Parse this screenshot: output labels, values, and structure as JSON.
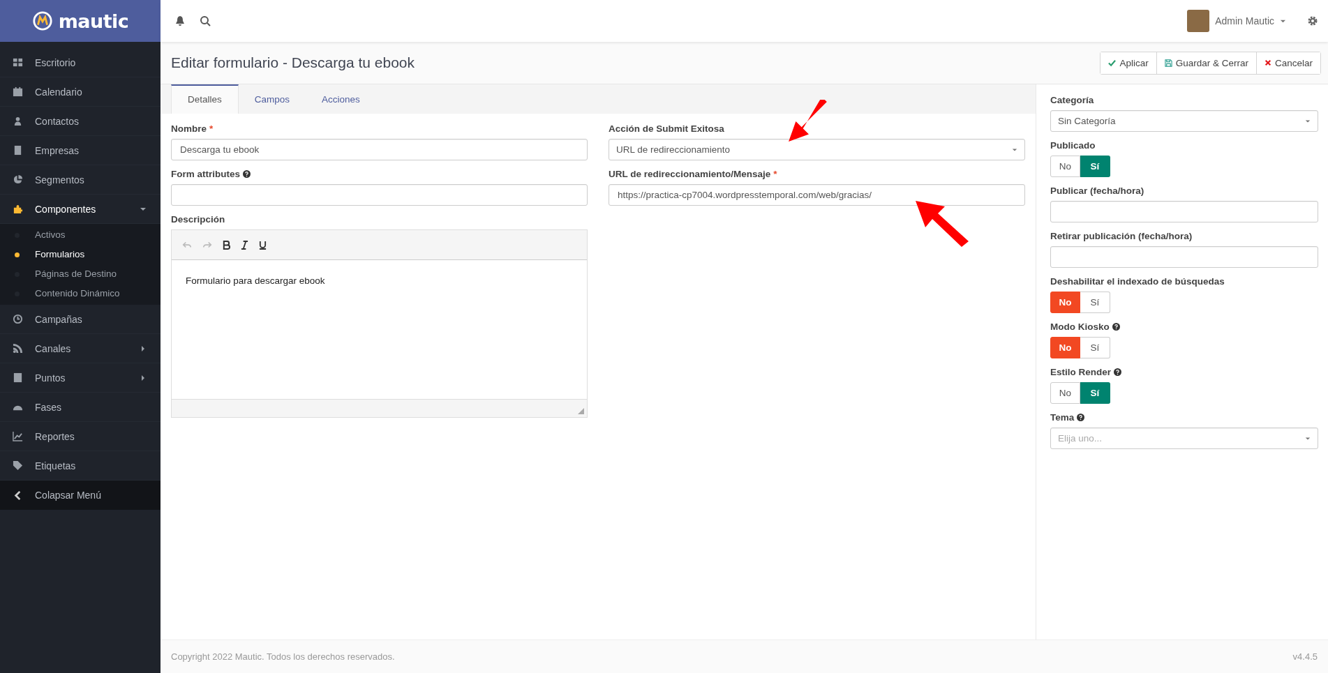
{
  "brand": {
    "name": "mautic"
  },
  "sidebar": {
    "items": [
      {
        "label": "Escritorio",
        "expanded": false,
        "has_submenu": false
      },
      {
        "label": "Calendario",
        "expanded": false,
        "has_submenu": false
      },
      {
        "label": "Contactos",
        "expanded": false,
        "has_submenu": false
      },
      {
        "label": "Empresas",
        "expanded": false,
        "has_submenu": false
      },
      {
        "label": "Segmentos",
        "expanded": false,
        "has_submenu": false
      },
      {
        "label": "Componentes",
        "expanded": true,
        "has_submenu": true,
        "children": [
          {
            "label": "Activos",
            "selected": false
          },
          {
            "label": "Formularios",
            "selected": true
          },
          {
            "label": "Páginas de Destino",
            "selected": false
          },
          {
            "label": "Contenido Dinámico",
            "selected": false
          }
        ]
      },
      {
        "label": "Campañas",
        "expanded": false,
        "has_submenu": false
      },
      {
        "label": "Canales",
        "expanded": false,
        "has_submenu": true
      },
      {
        "label": "Puntos",
        "expanded": false,
        "has_submenu": true
      },
      {
        "label": "Fases",
        "expanded": false,
        "has_submenu": false
      },
      {
        "label": "Reportes",
        "expanded": false,
        "has_submenu": false
      },
      {
        "label": "Etiquetas",
        "expanded": false,
        "has_submenu": false
      }
    ],
    "collapse": "Colapsar Menú"
  },
  "topbar": {
    "user": "Admin Mautic"
  },
  "page": {
    "title": "Editar formulario - Descarga tu ebook",
    "buttons": [
      {
        "label": "Aplicar",
        "kind": "apply"
      },
      {
        "label": "Guardar & Cerrar",
        "kind": "save"
      },
      {
        "label": "Cancelar",
        "kind": "cancel"
      }
    ]
  },
  "tabs": [
    {
      "label": "Detalles",
      "selected": true
    },
    {
      "label": "Campos",
      "selected": false
    },
    {
      "label": "Acciones",
      "selected": false
    }
  ],
  "form": {
    "left": [
      {
        "kind": "text",
        "label": "Nombre",
        "required_mark": "*",
        "value": "Descarga tu ebook"
      },
      {
        "kind": "text",
        "label": "Form attributes",
        "help": true
      },
      {
        "kind": "editor",
        "label": "Descripción",
        "value": "Formulario para descargar ebook"
      }
    ],
    "right": [
      {
        "kind": "select",
        "label": "Acción de Submit Exitosa",
        "value": "URL de redireccionamiento"
      },
      {
        "kind": "text",
        "label": "URL de redireccionamiento/Mensaje",
        "required_mark": "*",
        "value": "https://practica-cp7004.wordpresstemporal.com/web/gracias/"
      }
    ]
  },
  "side_panel": [
    {
      "kind": "select",
      "label": "Categoría",
      "value": "Sin Categoría"
    },
    {
      "kind": "toggle",
      "label": "Publicado",
      "options": [
        {
          "label": "No",
          "selected": false
        },
        {
          "label": "Sí",
          "selected": true
        }
      ]
    },
    {
      "kind": "text",
      "label": "Publicar (fecha/hora)"
    },
    {
      "kind": "text",
      "label": "Retirar publicación (fecha/hora)"
    },
    {
      "kind": "toggle",
      "label": "Deshabilitar el indexado de búsquedas",
      "options": [
        {
          "label": "No",
          "selected": true
        },
        {
          "label": "Sí",
          "selected": false
        }
      ]
    },
    {
      "kind": "toggle",
      "label": "Modo Kiosko",
      "help": true,
      "options": [
        {
          "label": "No",
          "selected": true
        },
        {
          "label": "Sí",
          "selected": false
        }
      ]
    },
    {
      "kind": "toggle",
      "label": "Estilo Render",
      "help": true,
      "options": [
        {
          "label": "No",
          "selected": false
        },
        {
          "label": "Sí",
          "selected": true
        }
      ]
    },
    {
      "kind": "select",
      "label": "Tema",
      "help": true,
      "placeholder": "Elija uno..."
    }
  ],
  "footer": {
    "copyright": "Copyright 2022 Mautic. Todos los derechos reservados.",
    "version": "v4.4.5"
  }
}
